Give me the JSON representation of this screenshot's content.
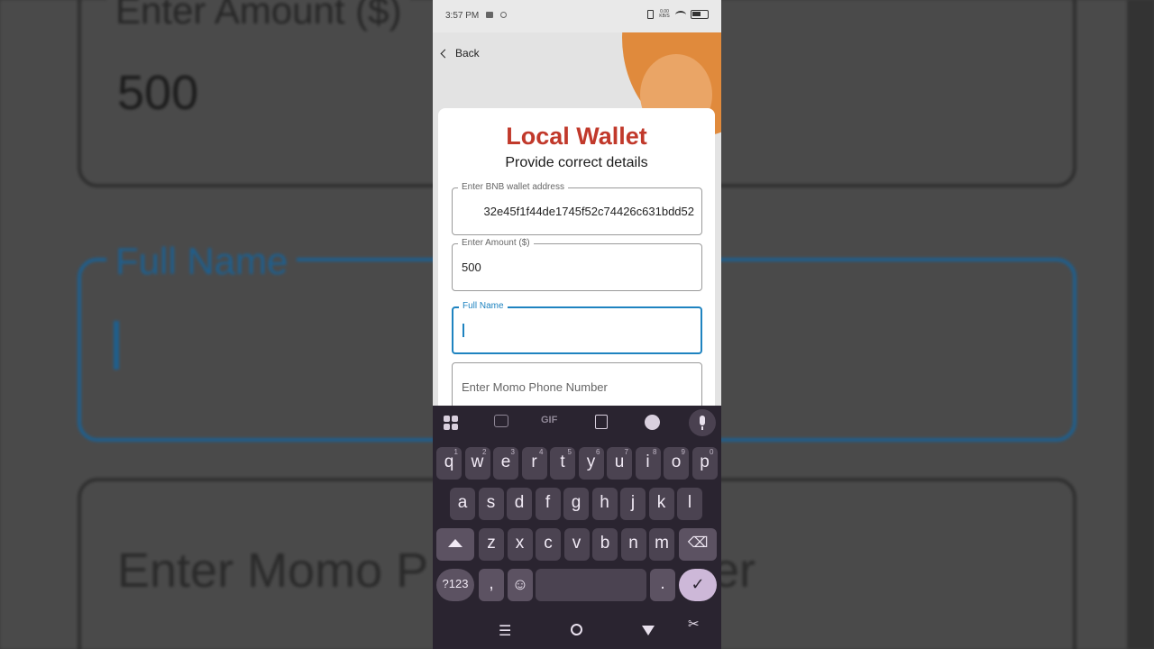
{
  "background": {
    "amount_label": "Enter Amount ($)",
    "amount_value": "500",
    "fullname_label": "Full Name",
    "momo_placeholder": "Enter Momo P",
    "momo_suffix": "er"
  },
  "status_bar": {
    "time": "3:57 PM",
    "net_speed": "0.00 KB/S"
  },
  "header": {
    "back_label": "Back"
  },
  "form": {
    "title": "Local Wallet",
    "subtitle": "Provide correct details",
    "wallet_label": "Enter BNB wallet address",
    "wallet_value": "32e45f1f44de1745f52c74426c631bdd52",
    "amount_label": "Enter Amount ($)",
    "amount_value": "500",
    "fullname_label": "Full Name",
    "fullname_value": "",
    "momo_placeholder": "Enter Momo Phone Number"
  },
  "keyboard": {
    "toolbar": {
      "gif_label": "GIF"
    },
    "row1": [
      {
        "k": "q",
        "n": "1"
      },
      {
        "k": "w",
        "n": "2"
      },
      {
        "k": "e",
        "n": "3"
      },
      {
        "k": "r",
        "n": "4"
      },
      {
        "k": "t",
        "n": "5"
      },
      {
        "k": "y",
        "n": "6"
      },
      {
        "k": "u",
        "n": "7"
      },
      {
        "k": "i",
        "n": "8"
      },
      {
        "k": "o",
        "n": "9"
      },
      {
        "k": "p",
        "n": "0"
      }
    ],
    "row2": [
      "a",
      "s",
      "d",
      "f",
      "g",
      "h",
      "j",
      "k",
      "l"
    ],
    "row3": [
      "z",
      "x",
      "c",
      "v",
      "b",
      "n",
      "m"
    ],
    "sym_label": "?123",
    "comma": ",",
    "period": "."
  },
  "colors": {
    "title": "#c1392b",
    "focus": "#1e83c0",
    "keyboard_bg": "#2a2430",
    "key_bg": "#4b4351",
    "accent_key": "#cdb8d8",
    "blob": "#e08a3c"
  }
}
